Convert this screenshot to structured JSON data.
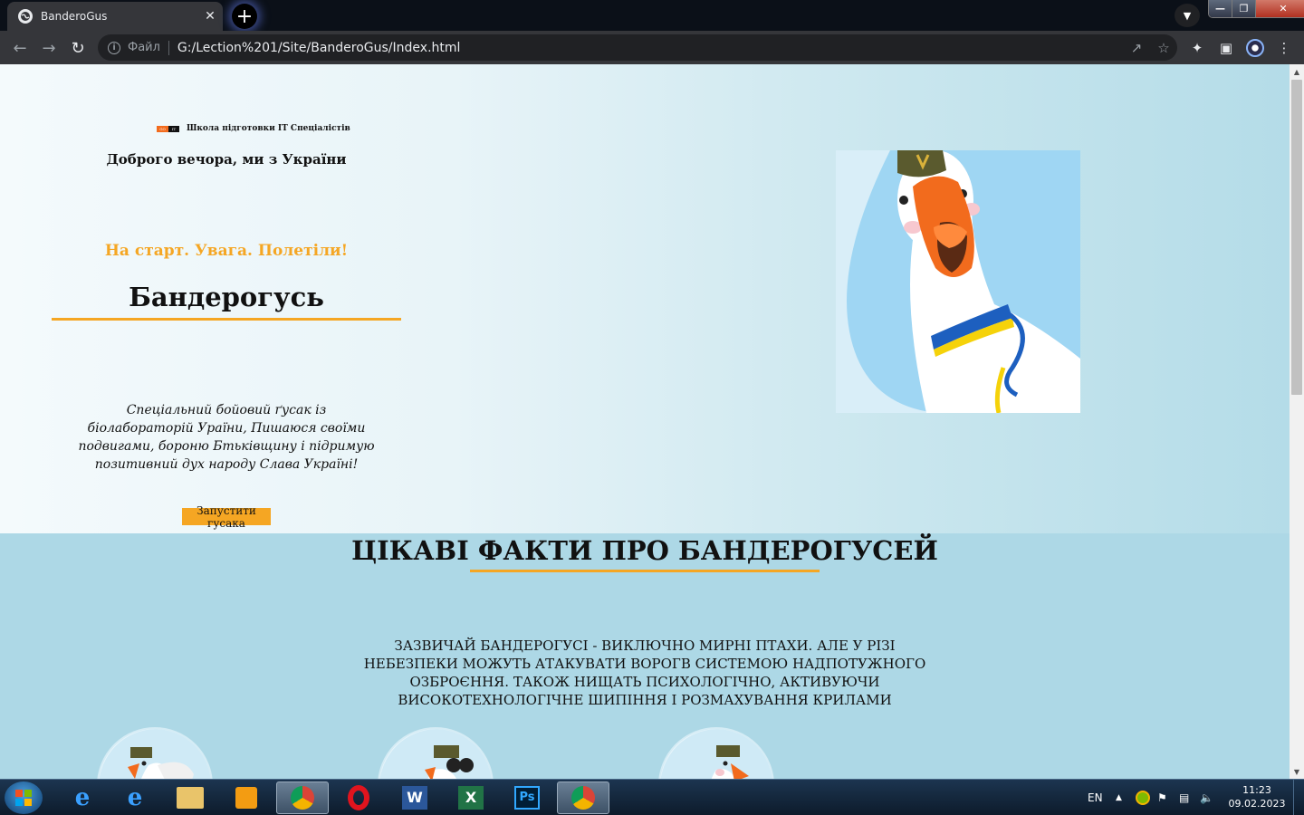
{
  "browser": {
    "tab_title": "BanderoGus",
    "tab_close": "✕",
    "new_tab": "+",
    "url_scheme": "Файл",
    "url": "G:/Lection%201/Site/BanderoGus/Index.html"
  },
  "hero": {
    "logo_go": "GO",
    "logo_it": "IT",
    "brand": "Школа підготовки IT Спеціалістів",
    "greeting": "Доброго вечора, ми з України",
    "tagline": "На старт. Увага. Полетіли!",
    "name": "Бандерогусь",
    "description": "Спеціальний бойовий ґусак із біолабораторій Ураїни, Пишаюся своїми подвигами, бороню Бтьківщину і підримую позитивний дух народу Слава Україні!",
    "button": "Запустити гусака"
  },
  "facts": {
    "title": "ЦІКАВІ ФАКТИ ПРО БАНДЕРОГУСЕЙ",
    "text": "Зазвичай бандерогусі - виключно мирні птахи. Але у різі небезпеки можуть атакувати ворогв системою надпотужного озброєння. Також нищать психологічно, активуючи високотехнологічне шипіння і розмахування крилами"
  },
  "taskbar": {
    "lang": "EN",
    "time": "11:23",
    "date": "09.02.2023"
  },
  "colors": {
    "accent": "#f5a623",
    "page_bg": "#add8e6"
  }
}
